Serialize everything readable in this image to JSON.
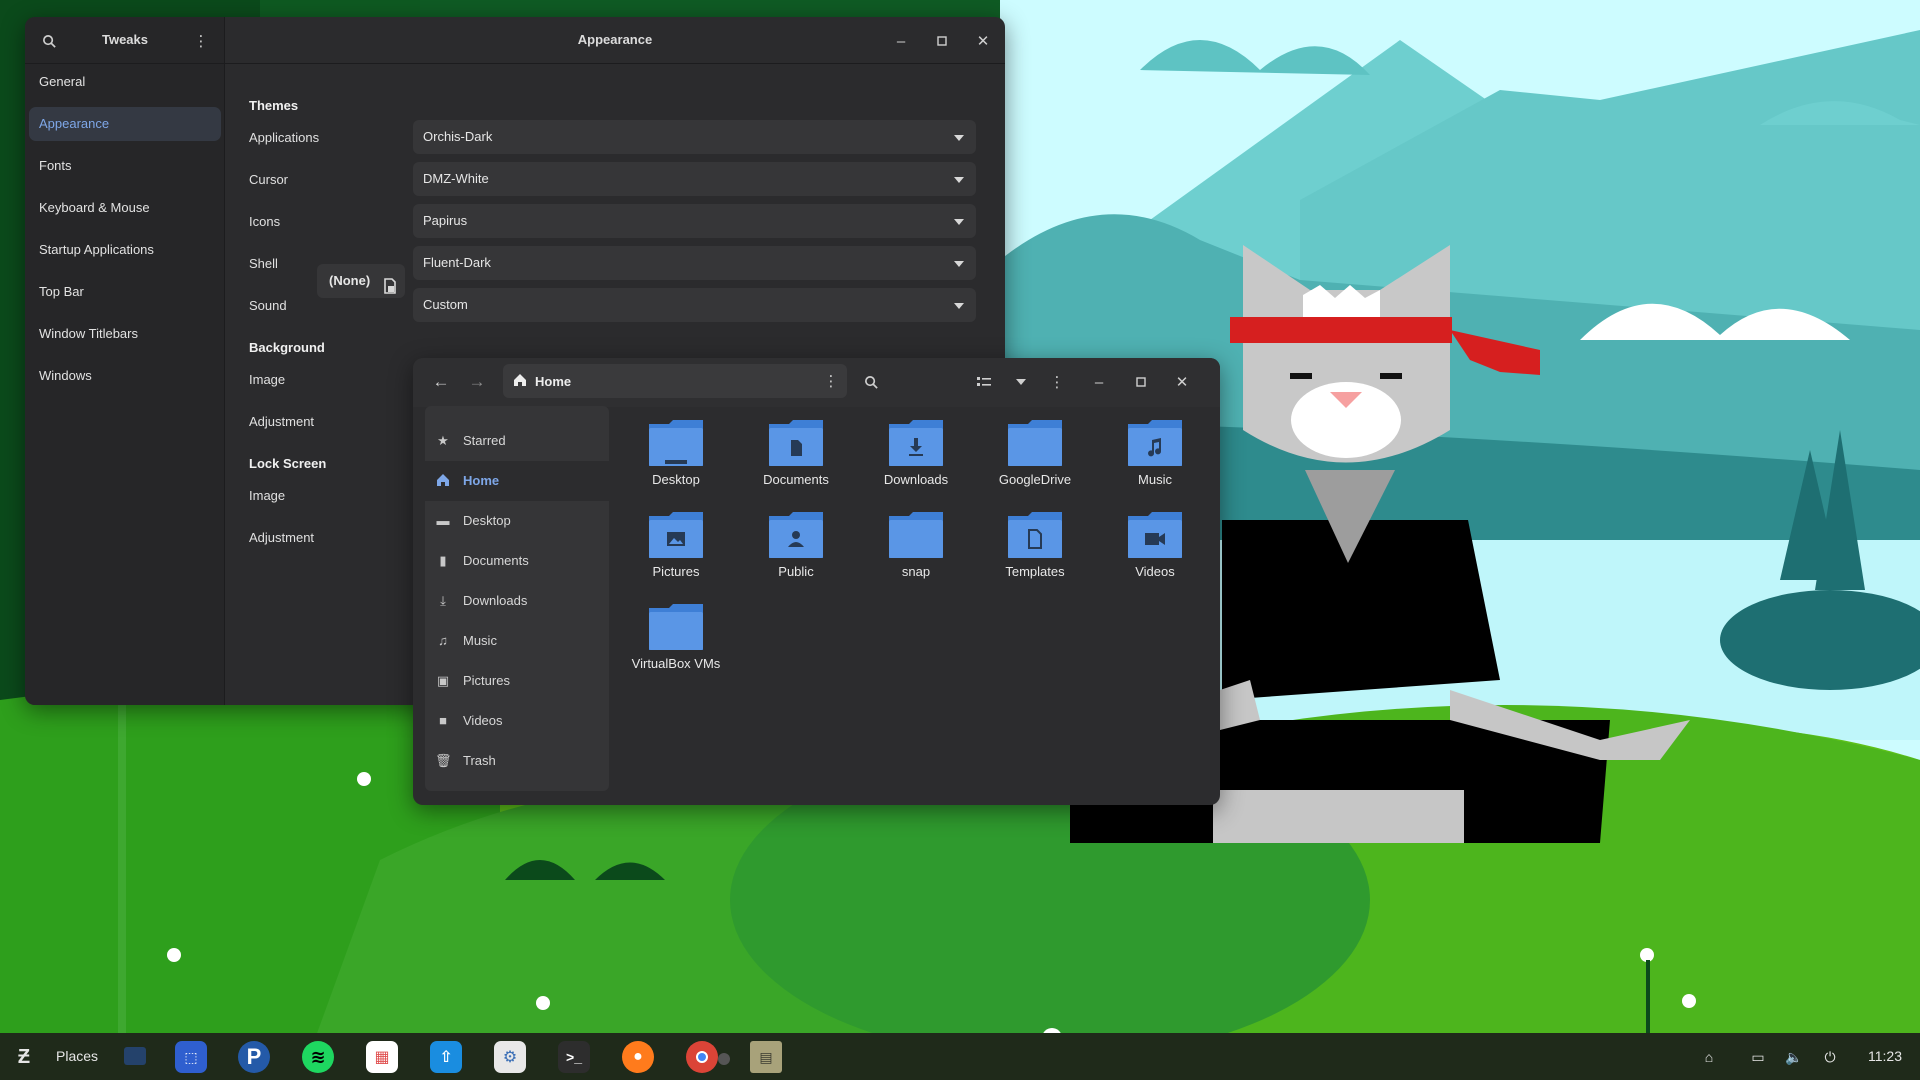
{
  "tweaks": {
    "app_title": "Tweaks",
    "page_title": "Appearance",
    "sidebar": [
      "General",
      "Appearance",
      "Fonts",
      "Keyboard & Mouse",
      "Startup Applications",
      "Top Bar",
      "Window Titlebars",
      "Windows"
    ],
    "active_item": "Appearance",
    "themes_header": "Themes",
    "applications_label": "Applications",
    "applications_value": "Orchis-Dark",
    "cursor_label": "Cursor",
    "cursor_value": "DMZ-White",
    "icons_label": "Icons",
    "icons_value": "Papirus",
    "shell_label": "Shell",
    "shell_file_value": "(None)",
    "shell_value": "Fluent-Dark",
    "sound_label": "Sound",
    "sound_value": "Custom",
    "background_header": "Background",
    "bg_image_label": "Image",
    "bg_adjustment_label": "Adjustment",
    "lockscreen_header": "Lock Screen",
    "ls_image_label": "Image",
    "ls_adjustment_label": "Adjustment"
  },
  "files": {
    "path": "Home",
    "sidebar": {
      "starred": "Starred",
      "home": "Home",
      "places": [
        "Desktop",
        "Documents",
        "Downloads",
        "Music",
        "Pictures",
        "Videos",
        "Trash"
      ]
    },
    "folders": [
      "Desktop",
      "Documents",
      "Downloads",
      "GoogleDrive",
      "Music",
      "Pictures",
      "Public",
      "snap",
      "Templates",
      "Videos",
      "VirtualBox VMs"
    ],
    "folder_color": "#5a96e6"
  },
  "taskbar": {
    "places_label": "Places",
    "clock": "11:23",
    "apps": [
      "Zorin menu",
      "Files",
      "Software",
      "Pandora",
      "Spotify",
      "Flathub",
      "Software Updater",
      "Tweaks",
      "Terminal",
      "Firefox",
      "Chrome",
      "Archive Manager"
    ]
  },
  "colors": {
    "accent": "#7ea7e8",
    "window_bg": "#2b2b2d",
    "sidebar_bg": "#262628"
  }
}
